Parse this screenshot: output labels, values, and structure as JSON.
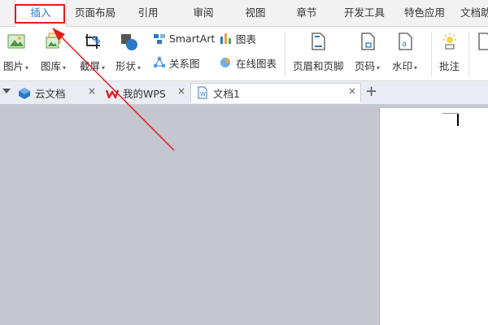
{
  "ribbon": {
    "tabs": [
      "插入",
      "页面布局",
      "引用",
      "审阅",
      "视图",
      "章节",
      "开发工具",
      "特色应用",
      "文档助"
    ],
    "active_tab": "插入"
  },
  "toolbar": {
    "picture": "图片",
    "gallery": "图库",
    "screenshot": "截屏",
    "shape": "形状",
    "smartart": "SmartArt",
    "relation_chart": "关系图",
    "chart": "图表",
    "online_chart": "在线图表",
    "header_footer": "页眉和页脚",
    "page_number": "页码",
    "watermark": "水印",
    "comment": "批注",
    "caret": "▾"
  },
  "doc_tabs": {
    "items": [
      "云文档",
      "我的WPS",
      "文档1"
    ],
    "active": "文档1",
    "close": "×",
    "add": "+"
  },
  "colors": {
    "accent": "#2b78c9",
    "highlight": "#e01c1c",
    "workspace": "#c4c7cf"
  }
}
